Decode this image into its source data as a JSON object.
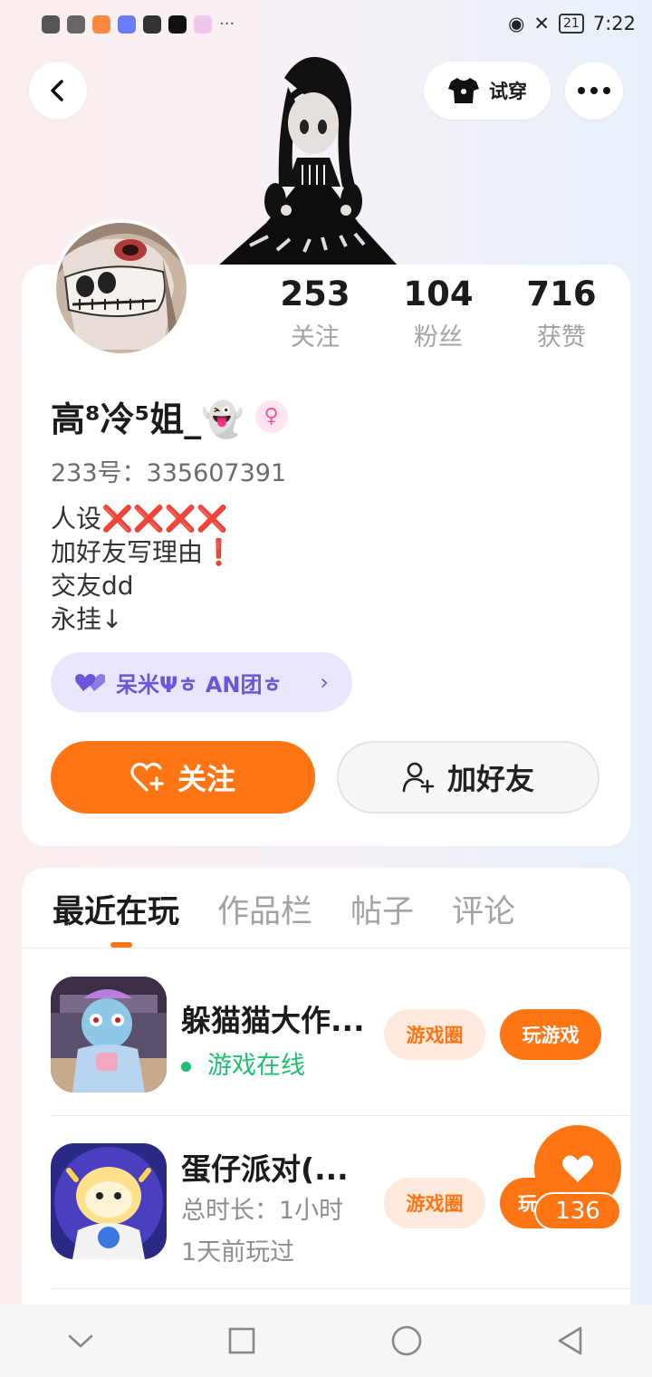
{
  "status_bar": {
    "time": "7:22",
    "battery": "21"
  },
  "header": {
    "try_on_label": "试穿"
  },
  "stats": [
    {
      "value": "253",
      "label": "关注"
    },
    {
      "value": "104",
      "label": "粉丝"
    },
    {
      "value": "716",
      "label": "获赞"
    }
  ],
  "profile": {
    "username": "高⁸冷⁵姐_👻",
    "gender_symbol": "♀",
    "uid": "233号：335607391",
    "bio": [
      "人设❌❌❌❌",
      "加好友写理由❗",
      "交友dd",
      "永挂↓"
    ],
    "club_name": "呆米Ψㅎ AN团ㅎ",
    "follow_label": "关注",
    "add_friend_label": "加好友"
  },
  "tabs": [
    {
      "label": "最近在玩"
    },
    {
      "label": "作品栏"
    },
    {
      "label": "帖子"
    },
    {
      "label": "评论"
    }
  ],
  "games": [
    {
      "title": "躲猫猫大作...",
      "status": "游戏在线",
      "circle_label": "游戏圈",
      "play_label": "玩游戏"
    },
    {
      "title": "蛋仔派对(...",
      "duration": "总时长：1小时",
      "last_played": "1天前玩过",
      "circle_label": "游戏圈",
      "play_label": "玩"
    }
  ],
  "like": {
    "count": "136"
  },
  "colors": {
    "accent": "#ff7514",
    "club": "#6e55d9",
    "online": "#1fbf6f"
  }
}
